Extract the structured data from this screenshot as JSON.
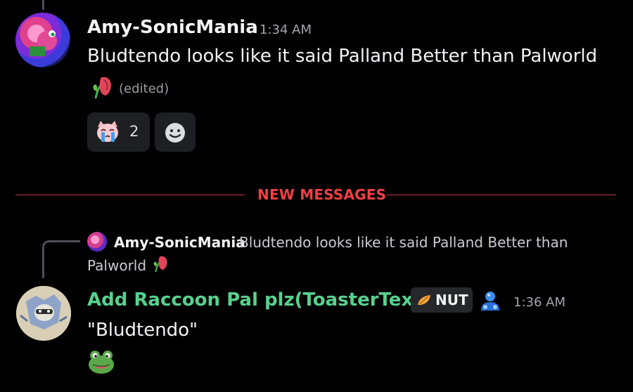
{
  "messages": [
    {
      "author": "Amy-SonicMania",
      "author_color": "#f2f3f5",
      "timestamp": "1:34 AM",
      "text": "Bludtendo looks like it said Palland Better than Palworld",
      "inline_emoji": "wilted-rose-icon",
      "edited_label": "(edited)",
      "reactions": [
        {
          "emoji": "crying-cat-emoji-icon",
          "count": "2"
        },
        {
          "emoji": "add-reaction-smiley-icon",
          "count": ""
        }
      ]
    },
    {
      "author": "Add Raccoon Pal plz(ToasterText)",
      "author_color": "#57d18e",
      "timestamp": "1:36 AM",
      "text": "\"Bludtendo\"",
      "tag": {
        "icon": "leaf-icon",
        "label": "NUT"
      },
      "badge_icon": "blue-orb-badge-icon",
      "attachment_emoji": "frog-emoji-icon",
      "reply": {
        "author": "Amy-SonicMania",
        "text_line1": "Bludtendo looks like it said Palland Better than",
        "text_line2": "Palworld",
        "emoji": "wilted-rose-icon"
      }
    }
  ],
  "divider": {
    "label": "NEW MESSAGES",
    "color": "#f23f42"
  }
}
